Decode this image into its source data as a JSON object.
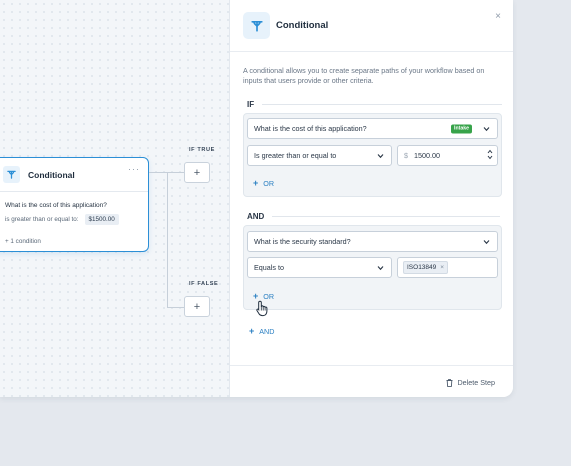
{
  "node": {
    "title": "Conditional",
    "menu": "···",
    "question": "What is the cost of this application?",
    "condition_label": "is greater than or equal to:",
    "condition_value": "$1500.00",
    "more_conditions": "+ 1 condition"
  },
  "branches": {
    "true_label": "IF TRUE",
    "false_label": "IF FALSE",
    "add_symbol": "+"
  },
  "panel": {
    "title": "Conditional",
    "close": "×",
    "description": "A conditional allows you to create separate paths of your workflow based on inputs that users provide or other criteria.",
    "if_group": {
      "label": "IF",
      "question": "What is the cost of this application?",
      "tag": "Intake",
      "operator": "Is greater than or equal to",
      "currency_symbol": "$",
      "value": "1500.00",
      "or_label": "OR"
    },
    "and_group": {
      "label": "AND",
      "question": "What is the security standard?",
      "operator": "Equals to",
      "chip": "ISO13849",
      "chip_remove": "×",
      "or_label": "OR"
    },
    "add_and_label": "AND",
    "add_symbol": "+",
    "delete_label": "Delete Step"
  },
  "colors": {
    "accent": "#2c8fd6",
    "link": "#2a7fc2",
    "intake_tag": "#37a34a"
  },
  "icons": [
    "split-icon",
    "more-dots-icon",
    "close-icon",
    "chevron-down-icon",
    "stepper-icon",
    "plus-icon",
    "trash-icon",
    "hand-cursor-icon"
  ]
}
